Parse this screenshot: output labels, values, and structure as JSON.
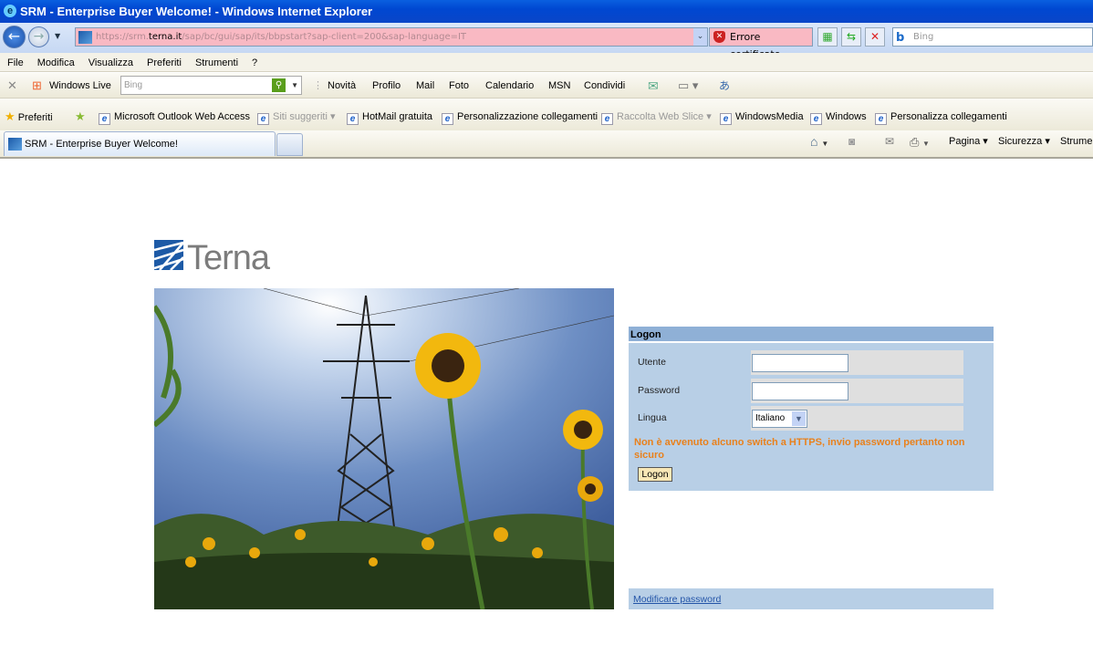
{
  "window": {
    "title": "SRM - Enterprise Buyer Welcome! - Windows Internet Explorer"
  },
  "address": {
    "url_prefix": "https://srm.",
    "url_domain": "terna.it",
    "url_suffix": "/sap/bc/gui/sap/its/bbpstart?sap-client=200&sap-language=IT",
    "cert_error": "Errore certificato",
    "search_placeholder": "Bing"
  },
  "menu": [
    "File",
    "Modifica",
    "Visualizza",
    "Preferiti",
    "Strumenti",
    "?"
  ],
  "toolbar": {
    "brand": "Windows Live",
    "search_placeholder": "Bing",
    "links": [
      "Novità",
      "Profilo",
      "Mail",
      "Foto",
      "Calendario",
      "MSN",
      "Condividi"
    ]
  },
  "favorites": {
    "label": "Preferiti",
    "items": [
      {
        "label": "Microsoft Outlook Web Access"
      },
      {
        "label": "Siti suggeriti ▾",
        "muted": true
      },
      {
        "label": "HotMail gratuita"
      },
      {
        "label": "Personalizzazione collegamenti"
      },
      {
        "label": "Raccolta Web Slice ▾",
        "muted": true
      },
      {
        "label": "WindowsMedia"
      },
      {
        "label": "Windows"
      },
      {
        "label": "Personalizza collegamenti"
      }
    ]
  },
  "tabs": [
    {
      "label": "SRM - Enterprise Buyer Welcome!",
      "active": true
    }
  ],
  "command_bar": {
    "pagina": "Pagina ▾",
    "sicurezza": "Sicurezza ▾",
    "strumenti": "Strumen"
  },
  "page": {
    "logo_text": "Terna",
    "logon": {
      "title": "Logon",
      "user_label": "Utente",
      "user_value": "",
      "password_label": "Password",
      "password_value": "",
      "language_label": "Lingua",
      "language_value": "Italiano",
      "warning": "Non è avvenuto alcuno switch a HTTPS, invio password pertanto non sicuro",
      "button": "Logon"
    },
    "change_password_link": "Modificare password"
  },
  "colors": {
    "panel": "#b8cfe6",
    "panel_header": "#8fb0d6",
    "warning": "#e9811c",
    "address_error": "#f9b9c3"
  }
}
